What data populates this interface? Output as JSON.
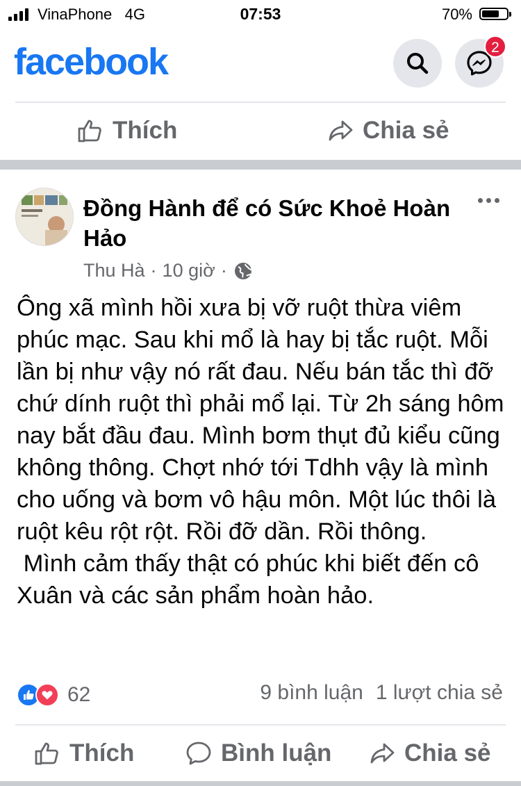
{
  "status_bar": {
    "carrier": "VinaPhone",
    "network": "4G",
    "time": "07:53",
    "battery": "70%",
    "battery_level": 0.7
  },
  "header": {
    "logo": "facebook",
    "brand_color": "#1877f2",
    "search_icon": "search-icon",
    "messenger_icon": "messenger-icon",
    "messenger_badge": "2"
  },
  "top_actions": {
    "like_label": "Thích",
    "share_label": "Chia sẻ"
  },
  "post": {
    "page_name": "Đồng Hành để có Sức Khoẻ Hoàn Hảo",
    "author": "Thu Hà",
    "time": "10 giờ",
    "separator": "·",
    "privacy_icon": "globe-icon",
    "body": "Ông xã mình hồi xưa bị vỡ ruột thừa viêm phúc mạc. Sau khi mổ là hay bị tắc ruột. Mỗi lần bị như vậy nó rất đau. Nếu bán tắc thì đỡ chứ dính ruột thì phải mổ lại. Từ 2h sáng hôm nay bắt đầu đau. Mình bơm thụt đủ kiểu cũng không thông. Chợt nhớ tới Tdhh vậy là mình cho uống và bơm vô hậu môn. Một lúc thôi là ruột kêu rột rột. Rồi đỡ dần. Rồi thông.\n Mình cảm thấy thật có phúc khi biết đến cô Xuân và các sản phẩm hoàn hảo.",
    "reaction_count": "62",
    "comments": "9 bình luận",
    "shares": "1 lượt chia sẻ"
  },
  "bottom_actions": {
    "like_label": "Thích",
    "comment_label": "Bình luận",
    "share_label": "Chia sẻ"
  }
}
